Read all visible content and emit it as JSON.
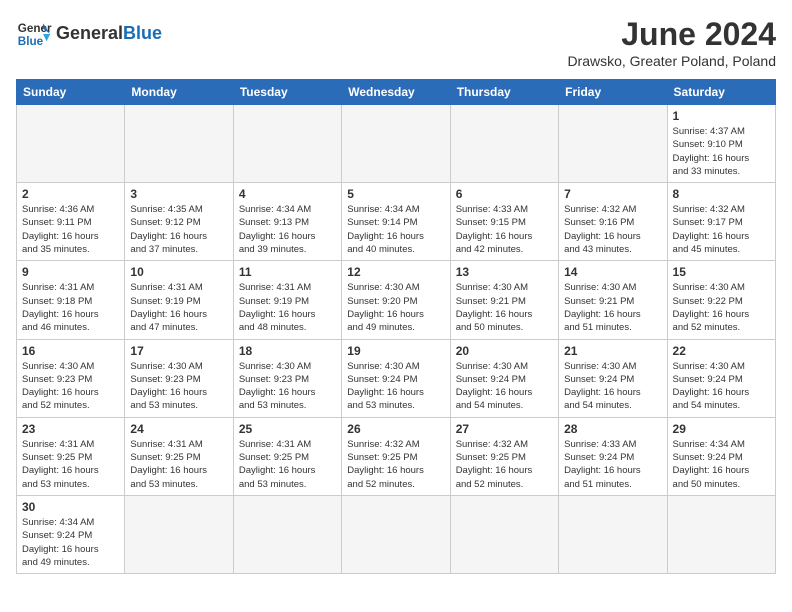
{
  "header": {
    "logo_general": "General",
    "logo_blue": "Blue",
    "month_title": "June 2024",
    "subtitle": "Drawsko, Greater Poland, Poland"
  },
  "weekdays": [
    "Sunday",
    "Monday",
    "Tuesday",
    "Wednesday",
    "Thursday",
    "Friday",
    "Saturday"
  ],
  "weeks": [
    [
      {
        "day": "",
        "info": ""
      },
      {
        "day": "",
        "info": ""
      },
      {
        "day": "",
        "info": ""
      },
      {
        "day": "",
        "info": ""
      },
      {
        "day": "",
        "info": ""
      },
      {
        "day": "",
        "info": ""
      },
      {
        "day": "1",
        "info": "Sunrise: 4:37 AM\nSunset: 9:10 PM\nDaylight: 16 hours\nand 33 minutes."
      }
    ],
    [
      {
        "day": "2",
        "info": "Sunrise: 4:36 AM\nSunset: 9:11 PM\nDaylight: 16 hours\nand 35 minutes."
      },
      {
        "day": "3",
        "info": "Sunrise: 4:35 AM\nSunset: 9:12 PM\nDaylight: 16 hours\nand 37 minutes."
      },
      {
        "day": "4",
        "info": "Sunrise: 4:34 AM\nSunset: 9:13 PM\nDaylight: 16 hours\nand 39 minutes."
      },
      {
        "day": "5",
        "info": "Sunrise: 4:34 AM\nSunset: 9:14 PM\nDaylight: 16 hours\nand 40 minutes."
      },
      {
        "day": "6",
        "info": "Sunrise: 4:33 AM\nSunset: 9:15 PM\nDaylight: 16 hours\nand 42 minutes."
      },
      {
        "day": "7",
        "info": "Sunrise: 4:32 AM\nSunset: 9:16 PM\nDaylight: 16 hours\nand 43 minutes."
      },
      {
        "day": "8",
        "info": "Sunrise: 4:32 AM\nSunset: 9:17 PM\nDaylight: 16 hours\nand 45 minutes."
      }
    ],
    [
      {
        "day": "9",
        "info": "Sunrise: 4:31 AM\nSunset: 9:18 PM\nDaylight: 16 hours\nand 46 minutes."
      },
      {
        "day": "10",
        "info": "Sunrise: 4:31 AM\nSunset: 9:19 PM\nDaylight: 16 hours\nand 47 minutes."
      },
      {
        "day": "11",
        "info": "Sunrise: 4:31 AM\nSunset: 9:19 PM\nDaylight: 16 hours\nand 48 minutes."
      },
      {
        "day": "12",
        "info": "Sunrise: 4:30 AM\nSunset: 9:20 PM\nDaylight: 16 hours\nand 49 minutes."
      },
      {
        "day": "13",
        "info": "Sunrise: 4:30 AM\nSunset: 9:21 PM\nDaylight: 16 hours\nand 50 minutes."
      },
      {
        "day": "14",
        "info": "Sunrise: 4:30 AM\nSunset: 9:21 PM\nDaylight: 16 hours\nand 51 minutes."
      },
      {
        "day": "15",
        "info": "Sunrise: 4:30 AM\nSunset: 9:22 PM\nDaylight: 16 hours\nand 52 minutes."
      }
    ],
    [
      {
        "day": "16",
        "info": "Sunrise: 4:30 AM\nSunset: 9:23 PM\nDaylight: 16 hours\nand 52 minutes."
      },
      {
        "day": "17",
        "info": "Sunrise: 4:30 AM\nSunset: 9:23 PM\nDaylight: 16 hours\nand 53 minutes."
      },
      {
        "day": "18",
        "info": "Sunrise: 4:30 AM\nSunset: 9:23 PM\nDaylight: 16 hours\nand 53 minutes."
      },
      {
        "day": "19",
        "info": "Sunrise: 4:30 AM\nSunset: 9:24 PM\nDaylight: 16 hours\nand 53 minutes."
      },
      {
        "day": "20",
        "info": "Sunrise: 4:30 AM\nSunset: 9:24 PM\nDaylight: 16 hours\nand 54 minutes."
      },
      {
        "day": "21",
        "info": "Sunrise: 4:30 AM\nSunset: 9:24 PM\nDaylight: 16 hours\nand 54 minutes."
      },
      {
        "day": "22",
        "info": "Sunrise: 4:30 AM\nSunset: 9:24 PM\nDaylight: 16 hours\nand 54 minutes."
      }
    ],
    [
      {
        "day": "23",
        "info": "Sunrise: 4:31 AM\nSunset: 9:25 PM\nDaylight: 16 hours\nand 53 minutes."
      },
      {
        "day": "24",
        "info": "Sunrise: 4:31 AM\nSunset: 9:25 PM\nDaylight: 16 hours\nand 53 minutes."
      },
      {
        "day": "25",
        "info": "Sunrise: 4:31 AM\nSunset: 9:25 PM\nDaylight: 16 hours\nand 53 minutes."
      },
      {
        "day": "26",
        "info": "Sunrise: 4:32 AM\nSunset: 9:25 PM\nDaylight: 16 hours\nand 52 minutes."
      },
      {
        "day": "27",
        "info": "Sunrise: 4:32 AM\nSunset: 9:25 PM\nDaylight: 16 hours\nand 52 minutes."
      },
      {
        "day": "28",
        "info": "Sunrise: 4:33 AM\nSunset: 9:24 PM\nDaylight: 16 hours\nand 51 minutes."
      },
      {
        "day": "29",
        "info": "Sunrise: 4:34 AM\nSunset: 9:24 PM\nDaylight: 16 hours\nand 50 minutes."
      }
    ],
    [
      {
        "day": "30",
        "info": "Sunrise: 4:34 AM\nSunset: 9:24 PM\nDaylight: 16 hours\nand 49 minutes."
      },
      {
        "day": "",
        "info": ""
      },
      {
        "day": "",
        "info": ""
      },
      {
        "day": "",
        "info": ""
      },
      {
        "day": "",
        "info": ""
      },
      {
        "day": "",
        "info": ""
      },
      {
        "day": "",
        "info": ""
      }
    ]
  ]
}
